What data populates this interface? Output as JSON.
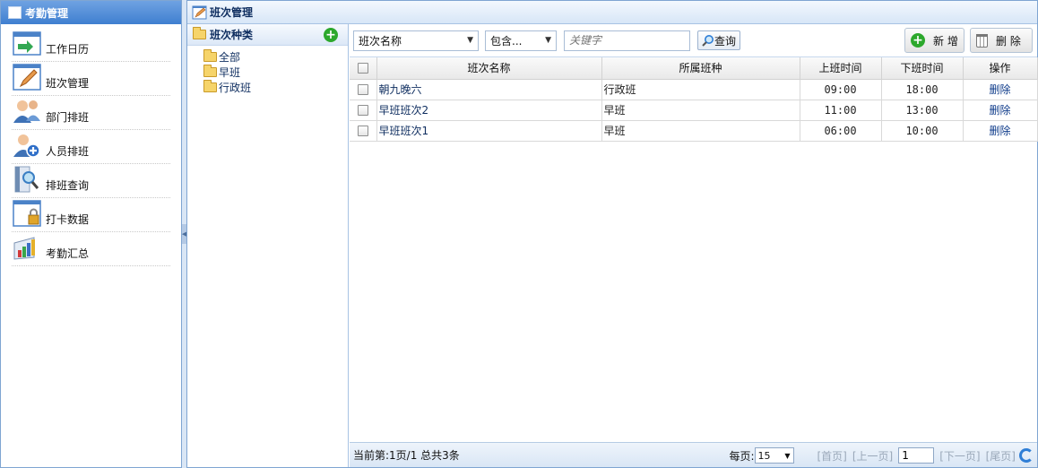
{
  "left_panel": {
    "title": "考勤管理",
    "items": [
      {
        "label": "工作日历",
        "icon": "calendar-arrow-icon"
      },
      {
        "label": "班次管理",
        "icon": "pencil-document-icon"
      },
      {
        "label": "部门排班",
        "icon": "department-users-icon"
      },
      {
        "label": "人员排班",
        "icon": "user-add-icon"
      },
      {
        "label": "排班查询",
        "icon": "search-document-icon"
      },
      {
        "label": "打卡数据",
        "icon": "lock-document-icon"
      },
      {
        "label": "考勤汇总",
        "icon": "chart-summary-icon"
      }
    ]
  },
  "main_panel": {
    "title": "班次管理"
  },
  "tree": {
    "header": "班次种类",
    "nodes": [
      "全部",
      "早班",
      "行政班"
    ]
  },
  "toolbar": {
    "field_select": "班次名称",
    "operator_select": "包含...",
    "keyword_placeholder": "关键字",
    "search_label": "查询",
    "add_label": "新 增",
    "delete_label": "删 除"
  },
  "grid": {
    "columns": [
      "班次名称",
      "所属班种",
      "上班时间",
      "下班时间",
      "操作"
    ],
    "rows": [
      {
        "name": "朝九晚六",
        "type": "行政班",
        "start": "09:00",
        "end": "18:00",
        "op": "删除"
      },
      {
        "name": "早班班次2",
        "type": "早班",
        "start": "11:00",
        "end": "13:00",
        "op": "删除"
      },
      {
        "name": "早班班次1",
        "type": "早班",
        "start": "06:00",
        "end": "10:00",
        "op": "删除"
      }
    ]
  },
  "pager": {
    "info": "当前第:1页/1 总共3条",
    "per_page_label": "每页:",
    "per_page_value": "15",
    "first": "[首页]",
    "prev": "[上一页]",
    "page_input": "1",
    "next": "[下一页]",
    "last": "[尾页]"
  },
  "colors": {
    "accent": "#3f7fd0",
    "link": "#0e2d5f",
    "add_green": "#2ca82c",
    "border": "#7fa5d2"
  }
}
